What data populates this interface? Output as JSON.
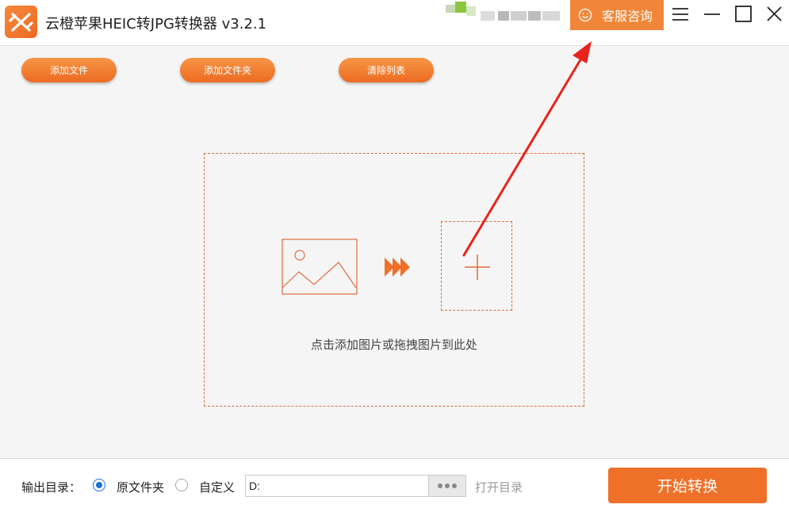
{
  "app": {
    "title": "云橙苹果HEIC转JPG转换器 v3.2.1",
    "logo_icon": "app-logo-icon"
  },
  "header": {
    "service_label": "客服咨询",
    "service_icon": "smile-icon",
    "menu_icon": "menu-icon",
    "minimize_icon": "minimize-icon",
    "maximize_icon": "maximize-icon",
    "close_icon": "close-icon"
  },
  "toolbar": {
    "add_file": "添加文件",
    "add_folder": "添加文件夹",
    "clear_list": "清除列表"
  },
  "dropzone": {
    "hint": "点击添加图片或拖拽图片到此处",
    "image_icon": "image-icon",
    "arrows_icon": "fast-forward-icon",
    "add_icon": "plus-icon"
  },
  "output": {
    "label": "输出目录：",
    "option_original": "原文件夹",
    "option_custom": "自定义",
    "selected": "原文件夹",
    "path_value": "D:",
    "open_dir": "打开目录",
    "start": "开始转换"
  },
  "colors": {
    "accent": "#ef7028",
    "button_gradient_top": "#f79546",
    "dash_border": "#e06a3a",
    "radio_selected": "#1e6fd6",
    "annotation_arrow": "#e8231c"
  }
}
